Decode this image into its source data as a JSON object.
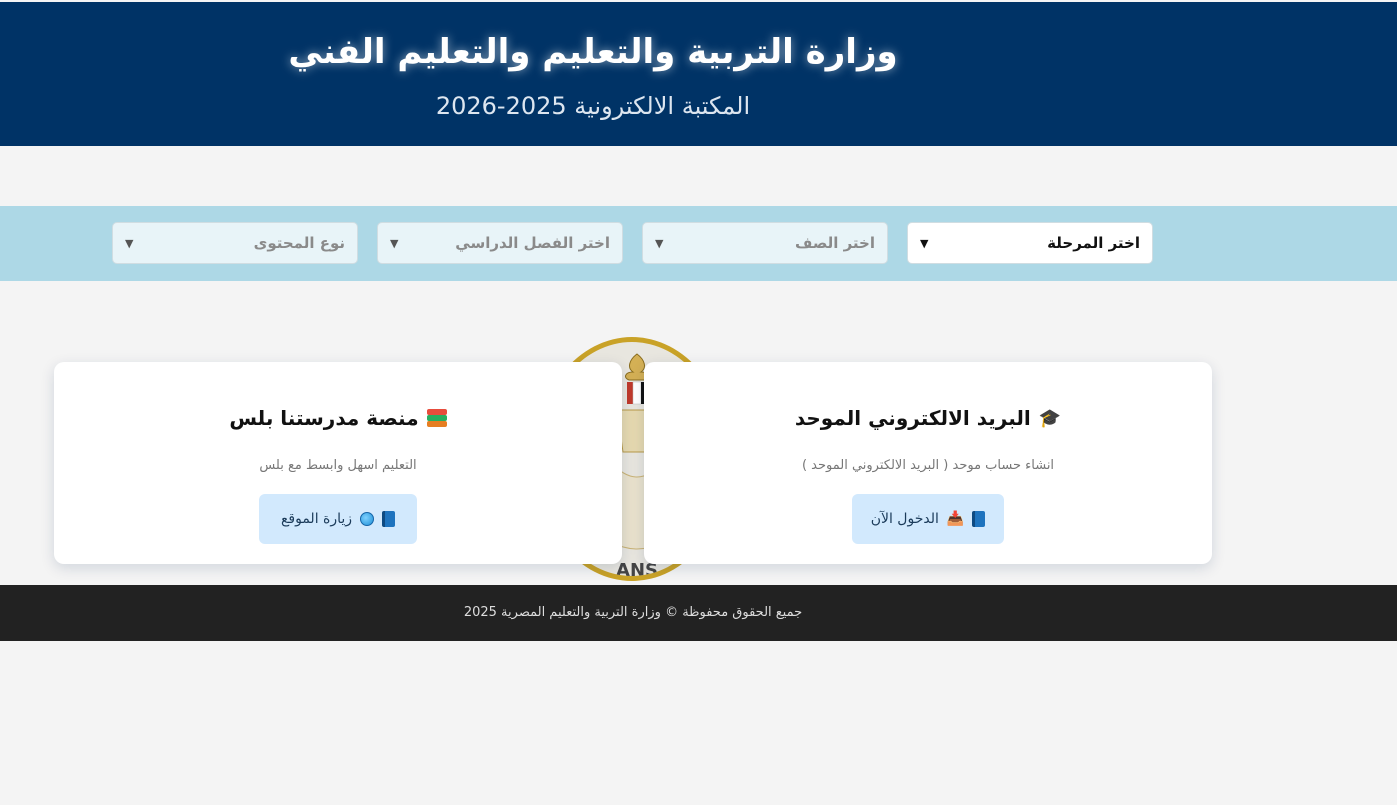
{
  "header": {
    "title": "وزارة التربية والتعليم والتعليم الفني",
    "subtitle": "المكتبة الالكترونية 2025-2026"
  },
  "filters": {
    "stage": "اختر المرحلة",
    "grade": "اختر الصف",
    "term": "اختر الفصل الدراسي",
    "content_type": "نوع المحتوى"
  },
  "emblem": {
    "text": "ANS"
  },
  "cards": {
    "email": {
      "icon": "graduation-cap-icon",
      "title": "البريد الالكتروني الموحد",
      "description": "انشاء حساب موحد ( البريد الالكتروني الموحد )",
      "button_label": "الدخول الآن"
    },
    "platform": {
      "icon": "books-icon",
      "title": "منصة مدرستنا بلس",
      "description": "التعليم اسهل وابسط مع بلس",
      "button_label": "زيارة الموقع"
    }
  },
  "footer": {
    "copyright": "جميع الحقوق محفوظة © وزارة التربية والتعليم المصرية 2025"
  },
  "colors": {
    "header_bg": "#003366",
    "filter_bar_bg": "#add8e6",
    "button_bg": "#d2e9fd",
    "footer_bg": "#222222",
    "emblem_ring": "#c9a227"
  }
}
